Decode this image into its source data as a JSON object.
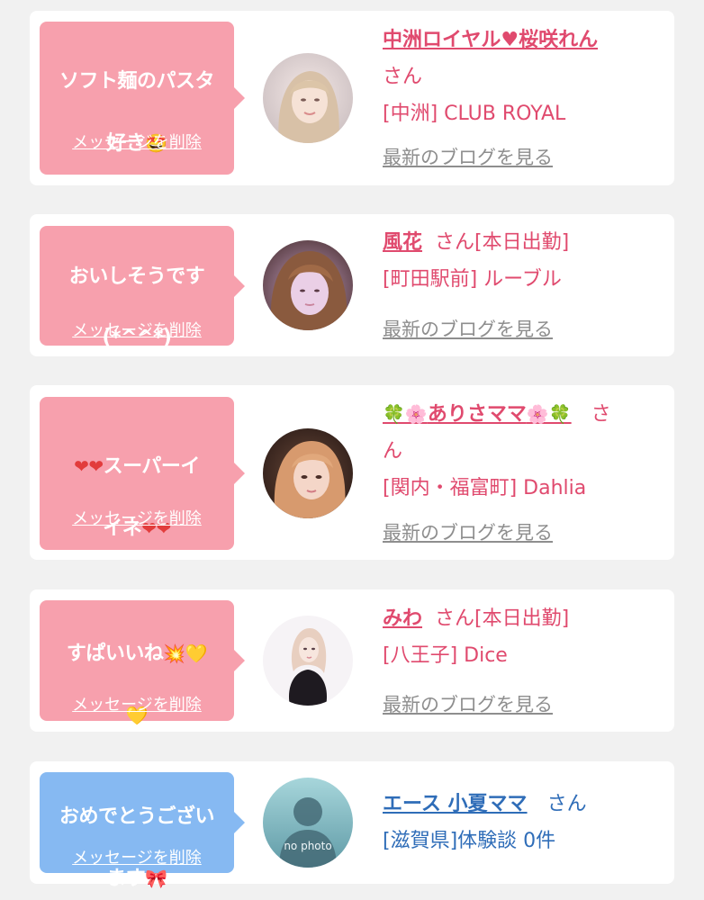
{
  "items": [
    {
      "message_a": "ソフト麺のパスタ",
      "message_b": "好き",
      "message_emoji": "🤩",
      "delete_label": "メッセージを削除",
      "name": "中洲ロイヤル♥桜咲れん",
      "san": "さん",
      "shop": "[中洲] CLUB ROYAL",
      "blog_label": "最新のブログを見る"
    },
    {
      "message_a": "おいしそうです",
      "message_b": "(*^^*)",
      "delete_label": "メッセージを削除",
      "name": "風花",
      "san": "さん[本日出勤]",
      "shop": "[町田駅前] ルーブル",
      "blog_label": "最新のブログを見る"
    },
    {
      "message_hearts": "❤❤",
      "message_a": "スーパーイ",
      "message_b": "イネ",
      "delete_label": "メッセージを削除",
      "name_deco_left": "🍀🌸",
      "name": "ありさママ",
      "name_deco_right": "🌸🍀",
      "san_a": "さ",
      "san_b": "ん",
      "shop": "[関内・福富町] Dahlia",
      "blog_label": "最新のブログを見る"
    },
    {
      "message_a": "すぱいいね",
      "message_emoji": "💥",
      "message_heart": "💛",
      "delete_label": "メッセージを削除",
      "name": "みわ",
      "san": "さん[本日出勤]",
      "shop": "[八王子] Dice",
      "blog_label": "最新のブログを見る"
    },
    {
      "message_a": "おめでとうござい",
      "message_b": "ます",
      "message_emoji": "🎀",
      "delete_label": "メッセージを削除",
      "name": "エース 小夏ママ",
      "san": "さん",
      "shop": "[滋賀県]体験談 0件",
      "no_photo": "no photo"
    }
  ],
  "colors": {
    "pink_bubble": "#f7a0ad",
    "blue_bubble": "#86b9f2",
    "pink_text": "#e04a6e",
    "blue_text": "#2f6db8"
  }
}
